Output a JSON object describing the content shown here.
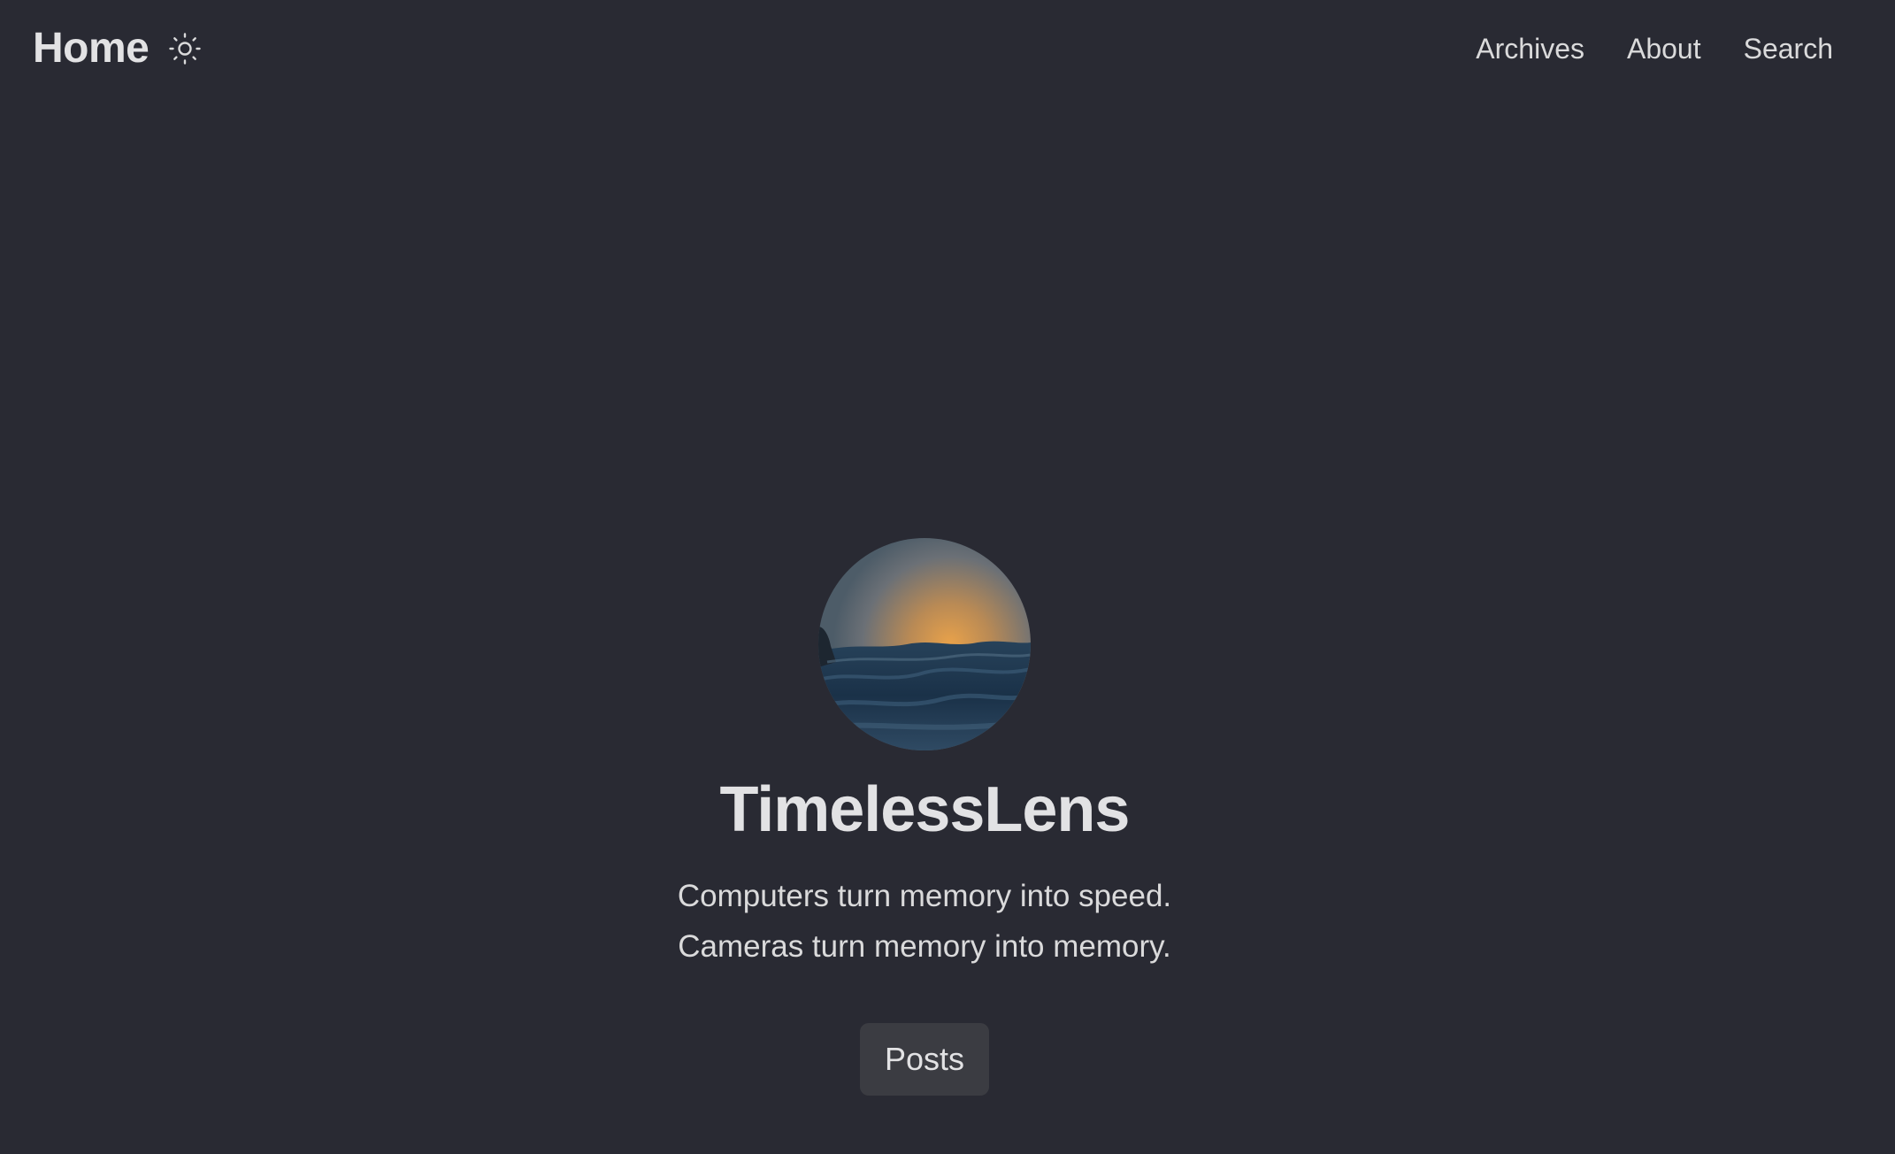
{
  "header": {
    "home_label": "Home",
    "theme_toggle_icon": "sun-icon",
    "nav": [
      {
        "label": "Archives"
      },
      {
        "label": "About"
      },
      {
        "label": "Search"
      }
    ]
  },
  "hero": {
    "avatar_icon": "sunset-over-ocean-avatar",
    "title": "TimelessLens",
    "tagline_line1": "Computers turn memory into speed.",
    "tagline_line2": "Cameras turn memory into memory.",
    "posts_button_label": "Posts"
  },
  "colors": {
    "background": "#292a33",
    "text": "#dadadb",
    "button_bg": "#3b3c42"
  }
}
